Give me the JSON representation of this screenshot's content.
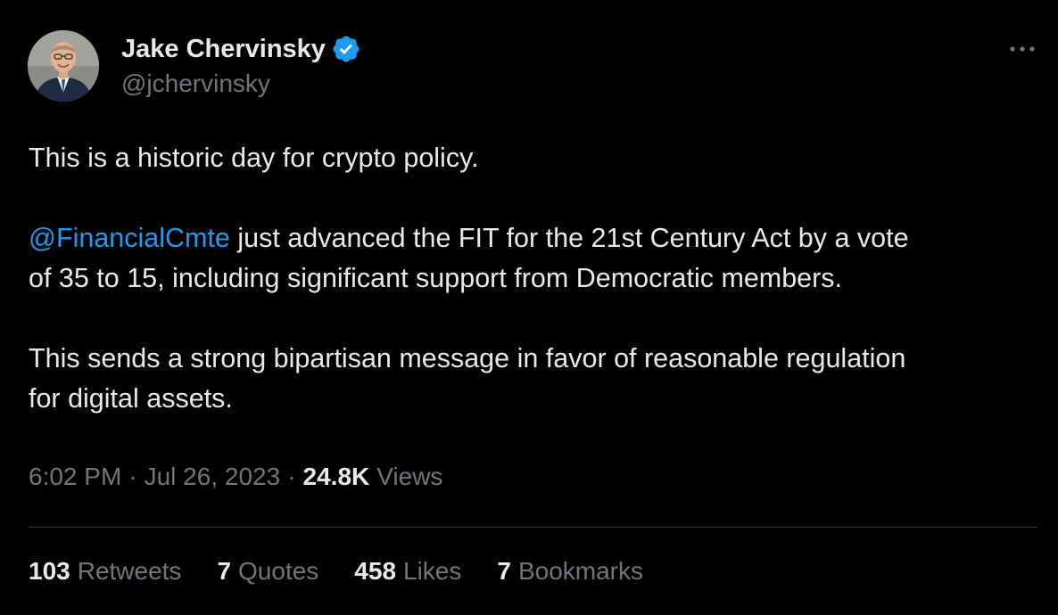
{
  "author": {
    "display_name": "Jake Chervinsky",
    "handle": "@jchervinsky",
    "verified_icon": "verified-badge-icon",
    "avatar_icon": "profile-photo"
  },
  "more_icon": "more-horizontal-icon",
  "tweet": {
    "paragraph1": "This is a historic day for crypto policy.",
    "mention": "@FinancialCmte",
    "paragraph2_line1_rest": " just advanced the FIT for the 21st Century Act by a vote",
    "paragraph2_line2": "of 35 to 15, including significant support from Democratic members.",
    "paragraph3_line1": "This sends a strong bipartisan message in favor of reasonable regulation",
    "paragraph3_line2": "for digital assets."
  },
  "meta": {
    "time": "6:02 PM",
    "separator": "·",
    "date": "Jul 26, 2023",
    "views_count": "24.8K",
    "views_label": "Views"
  },
  "stats": [
    {
      "count": "103",
      "label": "Retweets"
    },
    {
      "count": "7",
      "label": "Quotes"
    },
    {
      "count": "458",
      "label": "Likes"
    },
    {
      "count": "7",
      "label": "Bookmarks"
    }
  ],
  "colors": {
    "background": "#000000",
    "text": "#e7e9ea",
    "muted": "#71767b",
    "accent": "#1d9bf0",
    "divider": "#2f3336"
  }
}
